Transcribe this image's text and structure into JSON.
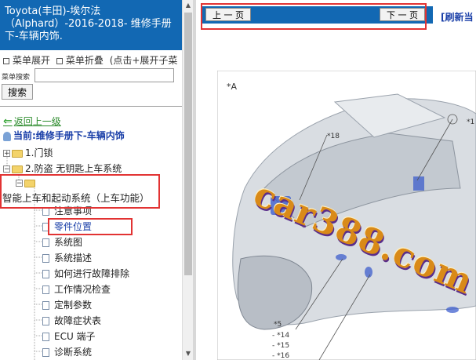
{
  "header": {
    "line1": "Toyota(丰田)-埃尔法",
    "line2": "（Alphard）-2016-2018- 维修手册",
    "line3": "下-车辆内饰."
  },
  "menu": {
    "expand": "菜单展开",
    "collapse": "菜单折叠",
    "hint": "(点击+展开子菜"
  },
  "search": {
    "label": "菜单搜索",
    "value": "",
    "button": "搜索"
  },
  "nav": {
    "back": "返回上一级",
    "current": "当前:维修手册下-车辆内饰"
  },
  "tree": {
    "node1": "1.门锁",
    "node2": "2.防盗 无钥匙上车系统",
    "node3": "智能上车和起动系统（上车功能）",
    "leaves": [
      "注意事项",
      "零件位置",
      "系统图",
      "系统描述",
      "如何进行故障排除",
      "工作情况检查",
      "定制参数",
      "故障症状表",
      "ECU 端子",
      "诊断系统"
    ]
  },
  "toolbar": {
    "prev": "上 一 页",
    "next": "下 一 页",
    "refresh": "[刷新当"
  },
  "diagram": {
    "label_a": "*A",
    "callouts": [
      "*18",
      "*1",
      "*5",
      "- *14",
      "- *15",
      "- *16"
    ]
  },
  "watermark": {
    "text": "car388.com"
  },
  "colors": {
    "header_bg": "#1268b3",
    "highlight_box": "#e23333",
    "link_green": "#2a8a2a",
    "current_blue": "#1a3fa8"
  }
}
